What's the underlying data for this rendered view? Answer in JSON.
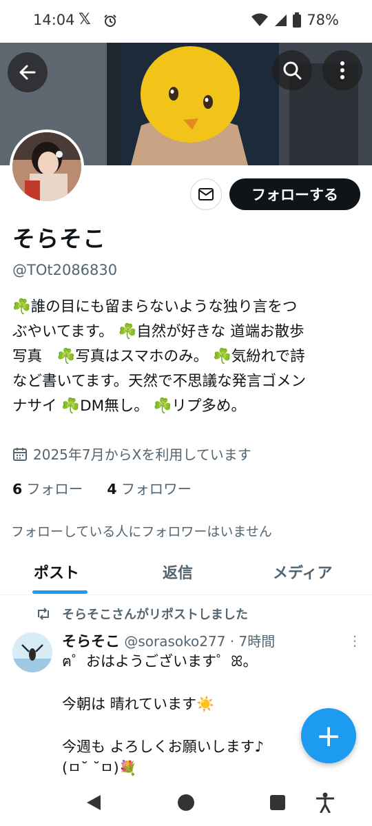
{
  "status_bar": {
    "time": "14:04",
    "x_glyph": "𝕏",
    "battery": "78%"
  },
  "profile": {
    "name": "そらそこ",
    "handle": "@TOt2086830",
    "follow_label": "フォローする",
    "bio_line_1": "☘️誰の目にも留まらないような独り言をつ",
    "bio_line_2": "ぶやいてます。 ☘️自然が好きな 道端お散歩",
    "bio_line_3": "写真　☘️写真はスマホのみ。 ☘️気紛れで詩",
    "bio_line_4": "など書いてます。天然で不思議な発言ゴメン",
    "bio_line_5": "ナサイ ☘️DM無し。 ☘️リプ多め。",
    "joined": "2025年7月からXを利用しています",
    "following_count": "6",
    "following_label": "フォロー",
    "followers_count": "4",
    "followers_label": "フォロワー",
    "no_followers_you_know": "フォローしている人にフォロワーはいません"
  },
  "tabs": [
    {
      "label": "ポスト"
    },
    {
      "label": "返信"
    },
    {
      "label": "メディア"
    }
  ],
  "post": {
    "repost_label": "そらそこさんがリポストしました",
    "author_name": "そらそこ",
    "author_handle": "@sorasoko277",
    "time": "· 7時間",
    "more": "⋮",
    "body": "ฅ゜おはようございます゜ꕤ。\n\n今朝は 晴れています☀️\n\n今週も よろしくお願いします♪\n(ㅁ˘ ˘ㅁ)💐"
  },
  "fab_label": "+",
  "colors": {
    "accent": "#1d9bf0",
    "follow_button": "#0f1419",
    "secondary_text": "#536471"
  },
  "icons": [
    "back-arrow-icon",
    "search-icon",
    "more-vertical-icon",
    "mail-icon",
    "calendar-icon",
    "repost-icon",
    "plus-icon"
  ]
}
